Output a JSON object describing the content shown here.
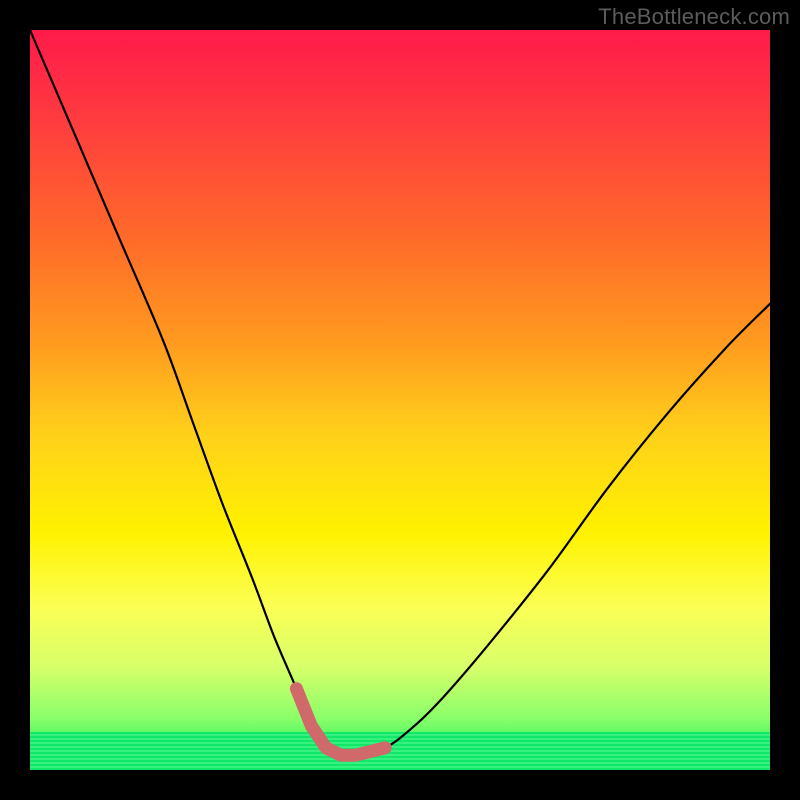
{
  "watermark": "TheBottleneck.com",
  "chart_data": {
    "type": "line",
    "title": "",
    "xlabel": "",
    "ylabel": "",
    "xlim": [
      0,
      100
    ],
    "ylim": [
      0,
      100
    ],
    "series": [
      {
        "name": "bottleneck-curve",
        "x": [
          0,
          6,
          12,
          18,
          22,
          26,
          30,
          33,
          36,
          38,
          40,
          42,
          44,
          48,
          52,
          56,
          62,
          70,
          78,
          86,
          94,
          100
        ],
        "values": [
          100,
          86,
          72,
          58,
          47,
          36,
          26,
          18,
          11,
          6,
          3,
          2,
          2,
          3,
          6,
          10,
          17,
          27,
          38,
          48,
          57,
          63
        ]
      }
    ],
    "annotations": [
      {
        "name": "valley-marker",
        "x_start": 36,
        "x_end": 48,
        "y": 2
      }
    ],
    "grid": false,
    "legend": false
  },
  "colors": {
    "curve": "#000000",
    "valley_marker": "#d06a6a",
    "background_top": "#ff1a4a",
    "background_bottom": "#00e85a"
  }
}
